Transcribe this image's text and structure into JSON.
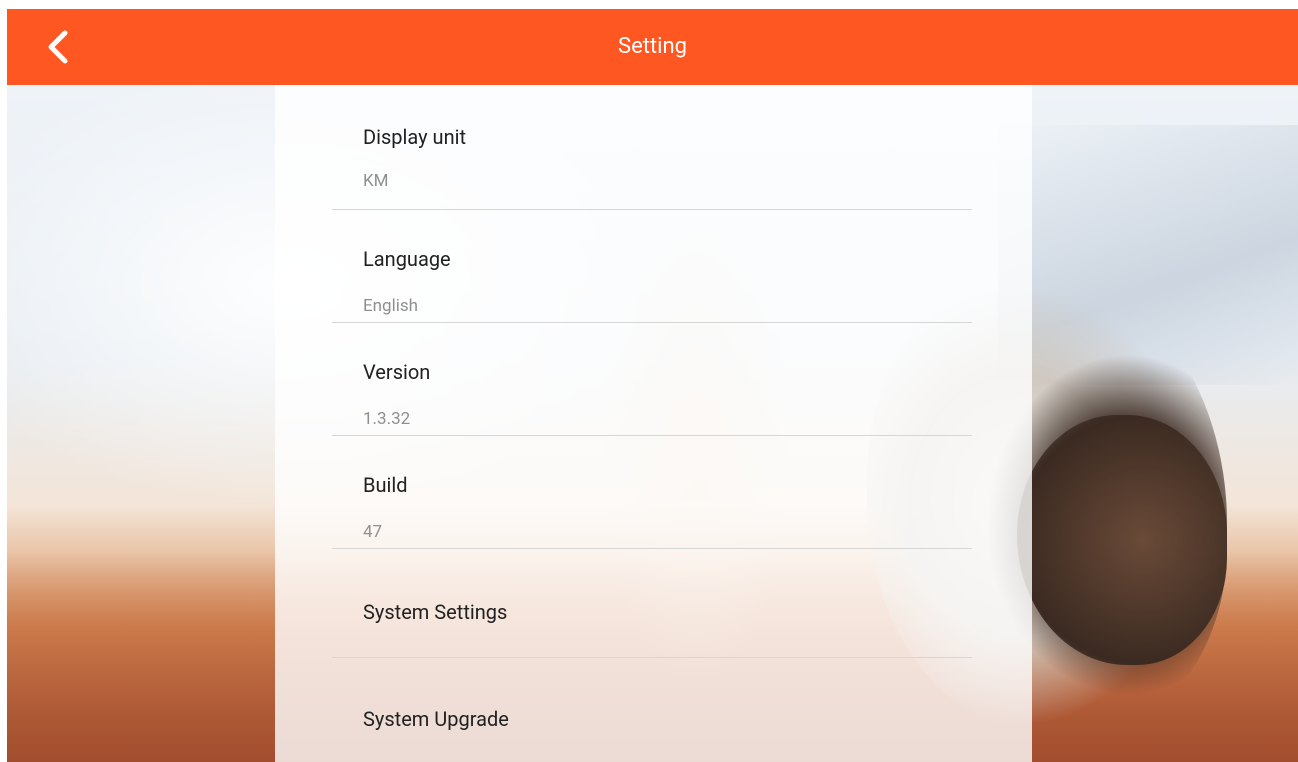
{
  "header": {
    "title": "Setting",
    "back_icon": "chevron-left-icon"
  },
  "colors": {
    "accent": "#ff5722"
  },
  "settings": [
    {
      "label": "Display unit",
      "value": "KM"
    },
    {
      "label": "Language",
      "value": "English"
    },
    {
      "label": "Version",
      "value": "1.3.32"
    },
    {
      "label": "Build",
      "value": "47"
    },
    {
      "label": "System Settings"
    },
    {
      "label": "System Upgrade"
    }
  ]
}
